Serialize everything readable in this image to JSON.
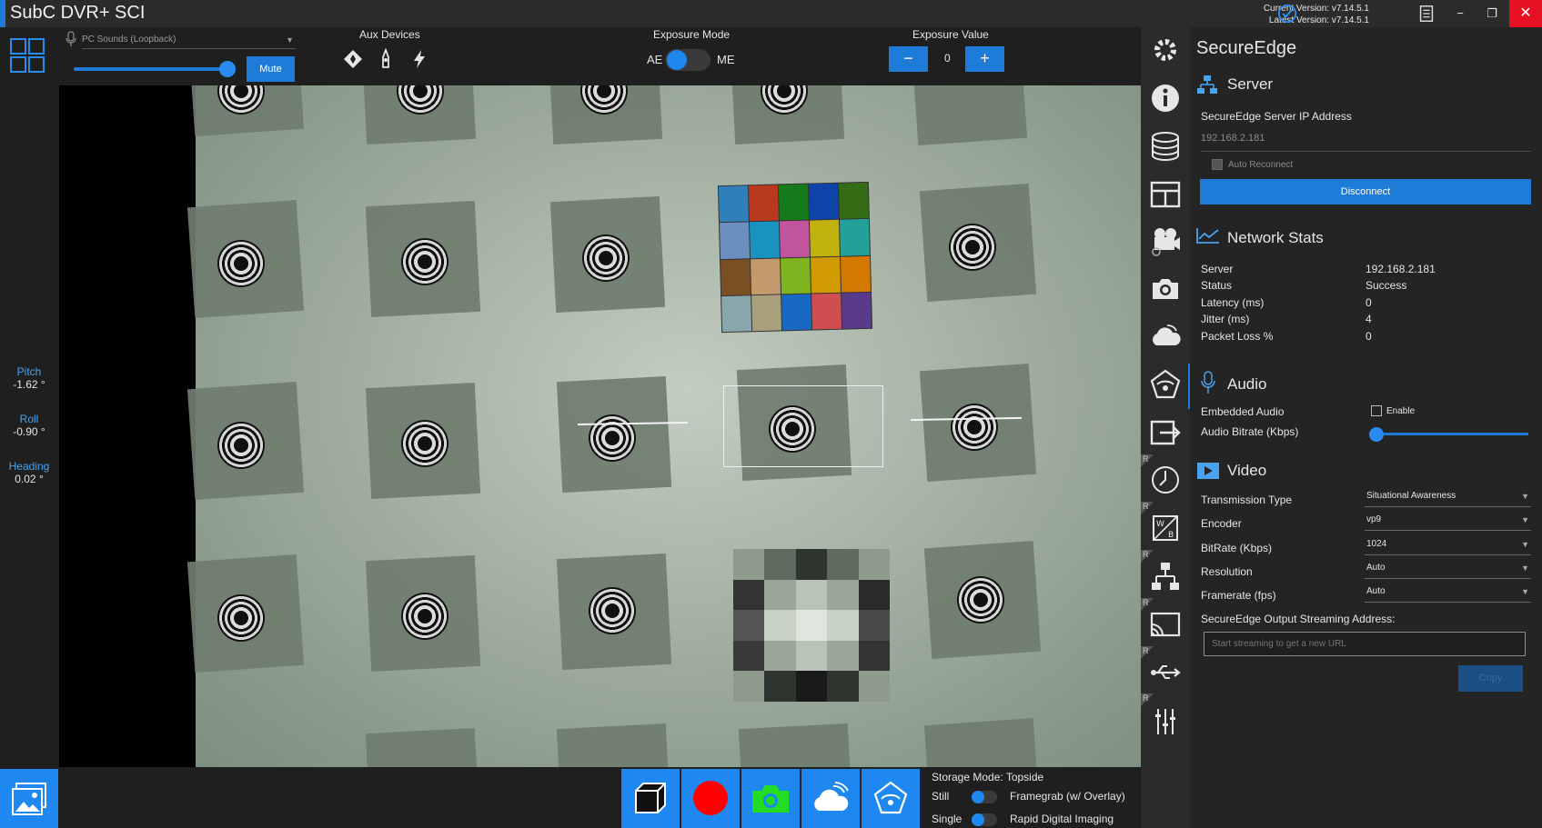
{
  "app": {
    "title": "SubC DVR+ SCI",
    "current_version": "Current Version: v7.14.5.1",
    "latest_version": "Latest Version: v7.14.5.1"
  },
  "audio": {
    "device": "PC Sounds (Loopback)",
    "mute_label": "Mute"
  },
  "aux": {
    "label": "Aux Devices"
  },
  "exposure_mode": {
    "label": "Exposure Mode",
    "ae": "AE",
    "me": "ME"
  },
  "exposure_value": {
    "label": "Exposure Value",
    "minus": "−",
    "plus": "+",
    "value": "0"
  },
  "attitude": {
    "pitch_label": "Pitch",
    "pitch": "-1.62 °",
    "roll_label": "Roll",
    "roll": "-0.90 °",
    "heading_label": "Heading",
    "heading": "0.02 °"
  },
  "panel": {
    "title": "SecureEdge",
    "server_heading": "Server",
    "ip_label": "SecureEdge Server IP Address",
    "ip_value": "192.168.2.181",
    "auto_reconnect": "Auto Reconnect",
    "disconnect": "Disconnect",
    "network_heading": "Network Stats",
    "stats": [
      {
        "label": "Server",
        "value": "192.168.2.181"
      },
      {
        "label": "Status",
        "value": "Success"
      },
      {
        "label": "Latency (ms)",
        "value": "0"
      },
      {
        "label": "Jitter (ms)",
        "value": "4"
      },
      {
        "label": "Packet Loss %",
        "value": "0"
      }
    ],
    "audio_heading": "Audio",
    "embedded_audio": "Embedded Audio",
    "enable": "Enable",
    "audio_bitrate": "Audio Bitrate (Kbps)",
    "video_heading": "Video",
    "video": [
      {
        "label": "Transmission Type",
        "value": "Situational Awareness"
      },
      {
        "label": "Encoder",
        "value": "vp9"
      },
      {
        "label": "BitRate (Kbps)",
        "value": "1024"
      },
      {
        "label": "Resolution",
        "value": "Auto"
      },
      {
        "label": "Framerate (fps)",
        "value": "Auto"
      }
    ],
    "output_label": "SecureEdge Output Streaming Address:",
    "output_placeholder": "Start streaming to get a new URL",
    "copy": "Copy"
  },
  "bottom": {
    "storage_mode": "Storage Mode: Topside",
    "still": "Still",
    "framegrab": "Framegrab (w/ Overlay)",
    "single": "Single",
    "rdi": "Rapid Digital Imaging"
  },
  "sidebar_flag": "R",
  "colors": {
    "accent": "#1f7bd8",
    "close": "#e81123",
    "record": "#ff0000",
    "camera_green": "#22dd22"
  }
}
